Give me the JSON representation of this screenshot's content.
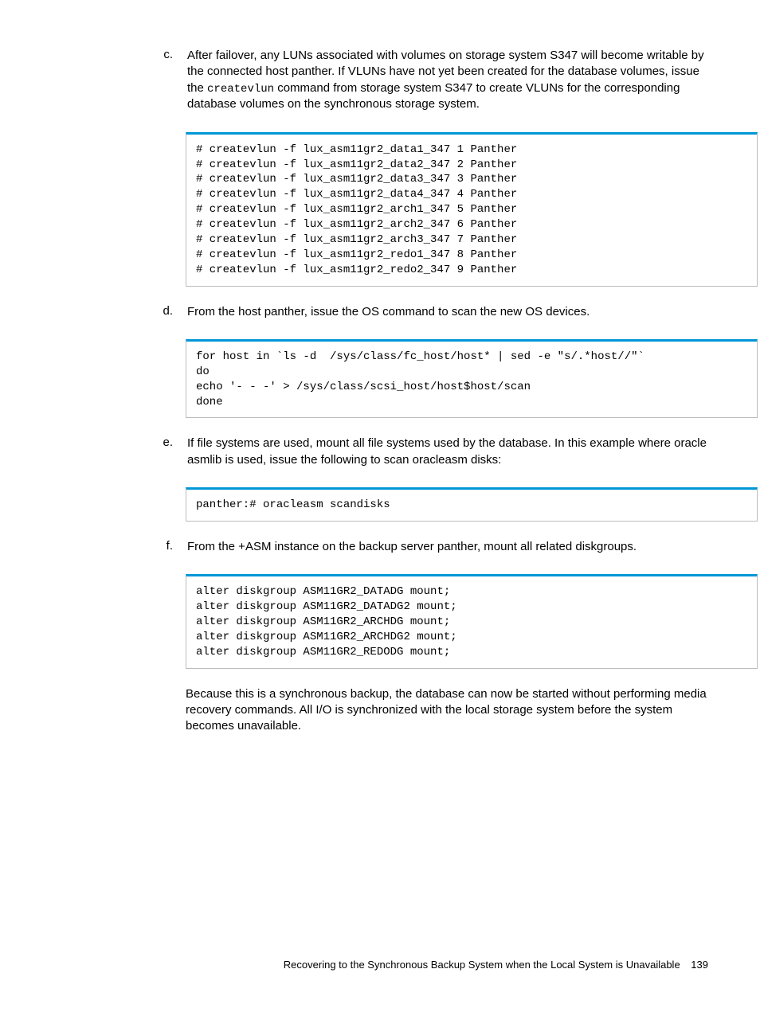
{
  "steps": {
    "c": {
      "marker": "c.",
      "text_before": "After failover, any LUNs associated with volumes on storage system S347 will become writable by the connected host panther. If VLUNs have not yet been created for the database volumes, issue the ",
      "code_inline": "createvlun",
      "text_after": " command from storage system S347 to create VLUNs for the corresponding database volumes on the synchronous storage system.",
      "code": "# createvlun -f lux_asm11gr2_data1_347 1 Panther\n# createvlun -f lux_asm11gr2_data2_347 2 Panther\n# createvlun -f lux_asm11gr2_data3_347 3 Panther\n# createvlun -f lux_asm11gr2_data4_347 4 Panther\n# createvlun -f lux_asm11gr2_arch1_347 5 Panther\n# createvlun -f lux_asm11gr2_arch2_347 6 Panther\n# createvlun -f lux_asm11gr2_arch3_347 7 Panther\n# createvlun -f lux_asm11gr2_redo1_347 8 Panther\n# createvlun -f lux_asm11gr2_redo2_347 9 Panther"
    },
    "d": {
      "marker": "d.",
      "text": "From the host panther, issue the OS command to scan the new OS devices.",
      "code": "for host in `ls -d  /sys/class/fc_host/host* | sed -e \"s/.*host//\"`\ndo\necho '- - -' > /sys/class/scsi_host/host$host/scan\ndone"
    },
    "e": {
      "marker": "e.",
      "text": "If file systems are used, mount all file systems used by the database. In this example where oracle asmlib is used, issue the following to scan oracleasm disks:",
      "code": "panther:# oracleasm scandisks"
    },
    "f": {
      "marker": "f.",
      "text": "From the +ASM instance on the backup server panther, mount all related diskgroups.",
      "code": "alter diskgroup ASM11GR2_DATADG mount;\nalter diskgroup ASM11GR2_DATADG2 mount;\nalter diskgroup ASM11GR2_ARCHDG mount;\nalter diskgroup ASM11GR2_ARCHDG2 mount;\nalter diskgroup ASM11GR2_REDODG mount;",
      "followup": "Because this is a synchronous backup, the database can now be started without performing media recovery commands. All I/O is synchronized with the local storage system before the system becomes unavailable."
    }
  },
  "footer": {
    "title": "Recovering to the Synchronous Backup System when the Local System is Unavailable",
    "page": "139"
  }
}
